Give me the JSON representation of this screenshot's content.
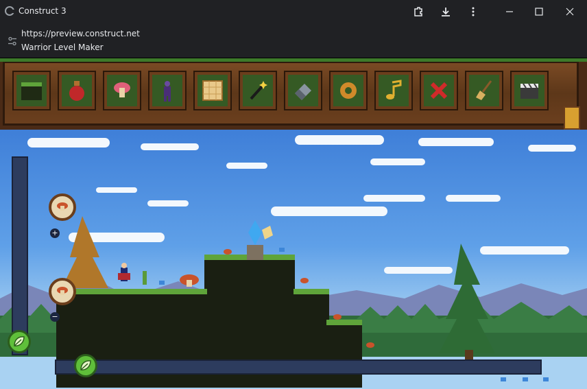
{
  "window": {
    "title": "Construct 3",
    "url": "https://preview.construct.net",
    "page_name": "Warrior Level Maker"
  },
  "toolbar": {
    "tools": [
      {
        "name": "tile-terrain",
        "icon": "grass-block-icon"
      },
      {
        "name": "potion",
        "icon": "red-potion-icon"
      },
      {
        "name": "mushroom",
        "icon": "mushroom-icon"
      },
      {
        "name": "enemy",
        "icon": "purple-warrior-icon"
      },
      {
        "name": "map",
        "icon": "parchment-map-icon"
      },
      {
        "name": "magic-wand",
        "icon": "wand-icon"
      },
      {
        "name": "eraser",
        "icon": "eraser-icon"
      },
      {
        "name": "settings",
        "icon": "gear-icon"
      },
      {
        "name": "music",
        "icon": "music-note-icon"
      },
      {
        "name": "delete",
        "icon": "red-x-icon"
      },
      {
        "name": "clear",
        "icon": "broom-icon"
      },
      {
        "name": "play",
        "icon": "clapperboard-icon"
      }
    ]
  },
  "colors": {
    "sky_top": "#3f7fd8",
    "grass": "#5fa43a",
    "ground": "#1a1f12",
    "wood": "#6b3f1e",
    "rail": "#2d3c5e"
  }
}
